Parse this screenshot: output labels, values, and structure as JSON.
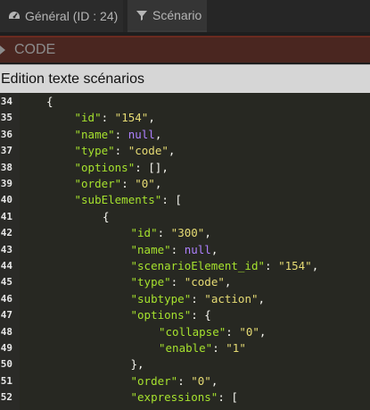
{
  "tabs": [
    {
      "label": "Général (ID : 24)",
      "icon": "dashboard-icon"
    },
    {
      "label": "Scénario",
      "icon": "filter-icon"
    }
  ],
  "code_section": {
    "label": "CODE",
    "icon": "collapse-triangle-icon"
  },
  "editor_title": "Edition texte scénarios",
  "editor_lines": [
    {
      "n": "34",
      "indent": 0,
      "tokens": [
        [
          "p",
          "{"
        ]
      ]
    },
    {
      "n": "35",
      "indent": 1,
      "tokens": [
        [
          "k",
          "\"id\""
        ],
        [
          "p",
          ": "
        ],
        [
          "s",
          "\"154\""
        ],
        [
          "p",
          ","
        ]
      ]
    },
    {
      "n": "36",
      "indent": 1,
      "tokens": [
        [
          "k",
          "\"name\""
        ],
        [
          "p",
          ": "
        ],
        [
          "n",
          "null"
        ],
        [
          "p",
          ","
        ]
      ]
    },
    {
      "n": "37",
      "indent": 1,
      "tokens": [
        [
          "k",
          "\"type\""
        ],
        [
          "p",
          ": "
        ],
        [
          "s",
          "\"code\""
        ],
        [
          "p",
          ","
        ]
      ]
    },
    {
      "n": "38",
      "indent": 1,
      "tokens": [
        [
          "k",
          "\"options\""
        ],
        [
          "p",
          ": [],"
        ]
      ]
    },
    {
      "n": "39",
      "indent": 1,
      "tokens": [
        [
          "k",
          "\"order\""
        ],
        [
          "p",
          ": "
        ],
        [
          "s",
          "\"0\""
        ],
        [
          "p",
          ","
        ]
      ]
    },
    {
      "n": "40",
      "indent": 1,
      "tokens": [
        [
          "k",
          "\"subElements\""
        ],
        [
          "p",
          ": ["
        ]
      ]
    },
    {
      "n": "41",
      "indent": 2,
      "tokens": [
        [
          "p",
          "{"
        ]
      ]
    },
    {
      "n": "42",
      "indent": 3,
      "tokens": [
        [
          "k",
          "\"id\""
        ],
        [
          "p",
          ": "
        ],
        [
          "s",
          "\"300\""
        ],
        [
          "p",
          ","
        ]
      ]
    },
    {
      "n": "43",
      "indent": 3,
      "tokens": [
        [
          "k",
          "\"name\""
        ],
        [
          "p",
          ": "
        ],
        [
          "n",
          "null"
        ],
        [
          "p",
          ","
        ]
      ]
    },
    {
      "n": "44",
      "indent": 3,
      "tokens": [
        [
          "k",
          "\"scenarioElement_id\""
        ],
        [
          "p",
          ": "
        ],
        [
          "s",
          "\"154\""
        ],
        [
          "p",
          ","
        ]
      ]
    },
    {
      "n": "45",
      "indent": 3,
      "tokens": [
        [
          "k",
          "\"type\""
        ],
        [
          "p",
          ": "
        ],
        [
          "s",
          "\"code\""
        ],
        [
          "p",
          ","
        ]
      ]
    },
    {
      "n": "46",
      "indent": 3,
      "tokens": [
        [
          "k",
          "\"subtype\""
        ],
        [
          "p",
          ": "
        ],
        [
          "s",
          "\"action\""
        ],
        [
          "p",
          ","
        ]
      ]
    },
    {
      "n": "47",
      "indent": 3,
      "tokens": [
        [
          "k",
          "\"options\""
        ],
        [
          "p",
          ": {"
        ]
      ]
    },
    {
      "n": "48",
      "indent": 4,
      "tokens": [
        [
          "k",
          "\"collapse\""
        ],
        [
          "p",
          ": "
        ],
        [
          "s",
          "\"0\""
        ],
        [
          "p",
          ","
        ]
      ]
    },
    {
      "n": "49",
      "indent": 4,
      "tokens": [
        [
          "k",
          "\"enable\""
        ],
        [
          "p",
          ": "
        ],
        [
          "s",
          "\"1\""
        ]
      ]
    },
    {
      "n": "50",
      "indent": 3,
      "tokens": [
        [
          "p",
          "},"
        ]
      ]
    },
    {
      "n": "51",
      "indent": 3,
      "tokens": [
        [
          "k",
          "\"order\""
        ],
        [
          "p",
          ": "
        ],
        [
          "s",
          "\"0\""
        ],
        [
          "p",
          ","
        ]
      ]
    },
    {
      "n": "52",
      "indent": 3,
      "tokens": [
        [
          "k",
          "\"expressions\""
        ],
        [
          "p",
          ": ["
        ]
      ]
    }
  ]
}
